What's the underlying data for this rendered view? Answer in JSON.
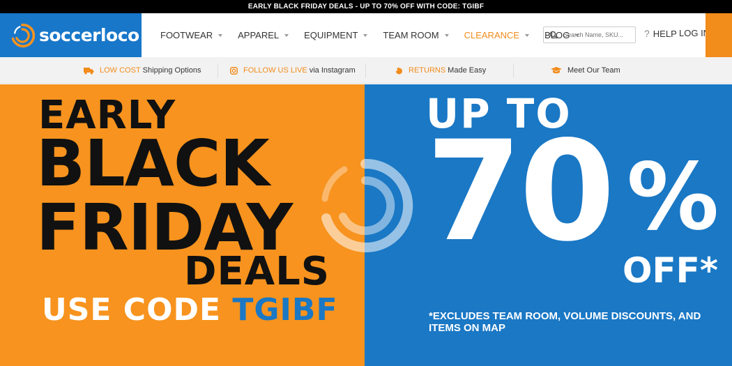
{
  "promo": {
    "text": "EARLY BLACK FRIDAY DEALS - UP TO 70% OFF WITH CODE: TGIBF"
  },
  "header": {
    "logo": "soccerloco",
    "nav": [
      {
        "label": "FOOTWEAR",
        "highlight": false
      },
      {
        "label": "APPAREL",
        "highlight": false
      },
      {
        "label": "EQUIPMENT",
        "highlight": false
      },
      {
        "label": "TEAM ROOM",
        "highlight": false
      },
      {
        "label": "CLEARANCE",
        "highlight": true
      },
      {
        "label": "BLOG",
        "highlight": false
      }
    ],
    "search_placeholder": "Search Name, SKU...",
    "help": "HELP",
    "login": "LOG IN"
  },
  "info": {
    "shipping": {
      "highlight": "LOW COST",
      "text": "Shipping Options",
      "icon": "truck-icon"
    },
    "instagram": {
      "highlight": "FOLLOW US LIVE",
      "text": "via Instagram",
      "icon": "instagram-icon"
    },
    "returns": {
      "highlight": "RETURNS",
      "text": "Made Easy",
      "icon": "returns-icon"
    },
    "team": {
      "text": "Meet Our Team",
      "icon": "team-icon"
    }
  },
  "hero": {
    "early": "EARLY",
    "black": "BLACK",
    "friday": "FRIDAY",
    "deals": "DEALS",
    "use_code": "USE CODE",
    "code": "TGIBF",
    "up_to": "UP TO",
    "percent": "70",
    "percent_sign": "%",
    "off": "OFF*",
    "exclusions": "*EXCLUDES TEAM ROOM, VOLUME DISCOUNTS, AND ITEMS ON MAP"
  },
  "colors": {
    "orange": "#f7931e",
    "blue": "#1a78c5",
    "black": "#111111"
  }
}
